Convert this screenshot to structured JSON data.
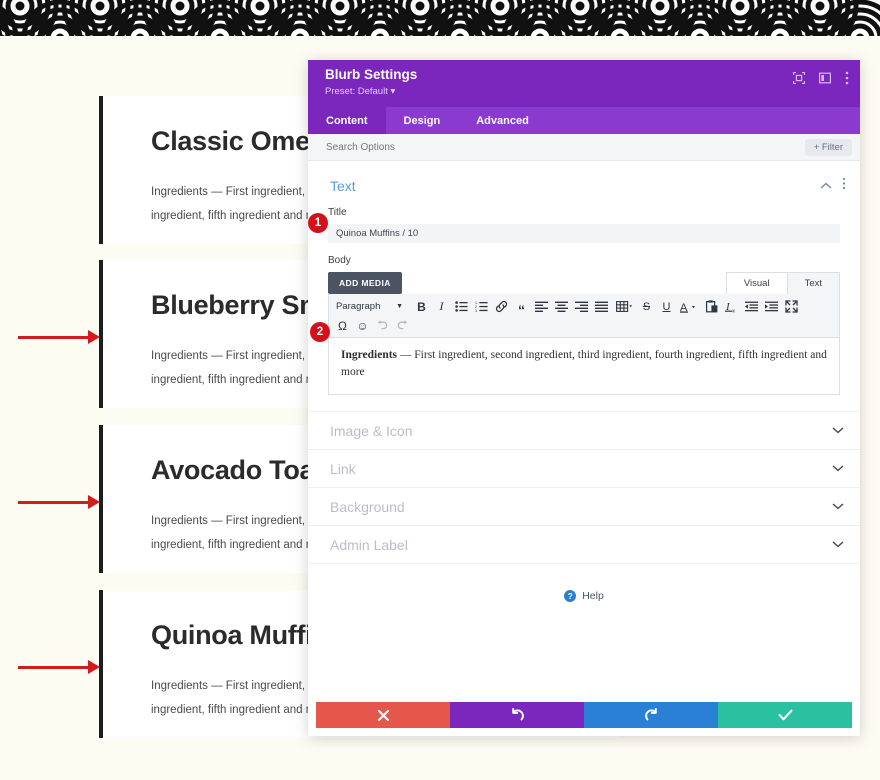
{
  "page": {
    "background_color": "#fdfcf3",
    "accent_purple": "#7b27bd",
    "annotation_color": "#d4101a"
  },
  "decor": {
    "pattern_name": "seigaiha-wave-pattern"
  },
  "recipe_cards": [
    {
      "title": "Classic Omelet",
      "body_label": "Ingredients",
      "body_line1": "Ingredients — First ingredient, second ingredient, third",
      "body_line2": "ingredient, fifth ingredient and more",
      "has_arrow": false
    },
    {
      "title": "Blueberry Smoothie",
      "body_label": "Ingredients",
      "body_line1": "Ingredients — First ingredient, second ingredient, third",
      "body_line2": "ingredient, fifth ingredient and more",
      "has_arrow": true
    },
    {
      "title": "Avocado Toast",
      "body_label": "Ingredients",
      "body_line1": "Ingredients — First ingredient, second ingredient, third",
      "body_line2": "ingredient, fifth ingredient and more",
      "has_arrow": true
    },
    {
      "title": "Quinoa Muffins",
      "body_label": "Ingredients",
      "body_line1": "Ingredients — First ingredient, second ingredient, third",
      "body_line2": "ingredient, fifth ingredient and more",
      "has_arrow": true
    }
  ],
  "annotations": [
    {
      "number": "1",
      "target": "title-field"
    },
    {
      "number": "2",
      "target": "body-editor"
    }
  ],
  "modal": {
    "title": "Blurb Settings",
    "preset": "Preset: Default ▾",
    "header_icons": [
      {
        "name": "fullscreen-icon"
      },
      {
        "name": "layout-panel-icon"
      },
      {
        "name": "more-vertical-icon"
      }
    ],
    "tabs": [
      {
        "label": "Content",
        "active": true
      },
      {
        "label": "Design",
        "active": false
      },
      {
        "label": "Advanced",
        "active": false
      }
    ],
    "search": {
      "placeholder": "Search Options",
      "value": "",
      "filter_label": "+ Filter"
    },
    "text_section": {
      "heading": "Text",
      "collapse_icon": "chevron-up-icon",
      "menu_icon": "more-vertical-icon",
      "title_field": {
        "label": "Title",
        "value": "Quinoa Muffins / 10"
      },
      "body_field": {
        "label": "Body",
        "add_media_label": "ADD MEDIA",
        "editor_tabs": [
          {
            "label": "Visual",
            "selected": true
          },
          {
            "label": "Text",
            "selected": false
          }
        ],
        "format_select": "Paragraph",
        "toolbar_row1": [
          {
            "name": "bold-icon",
            "glyph": "B"
          },
          {
            "name": "italic-icon",
            "glyph": "I"
          },
          {
            "name": "bulleted-list-icon",
            "glyph": "☰"
          },
          {
            "name": "numbered-list-icon",
            "glyph": "☰"
          },
          {
            "name": "link-icon",
            "glyph": "🔗"
          },
          {
            "name": "blockquote-icon",
            "glyph": "“"
          },
          {
            "name": "align-left-icon",
            "glyph": "☰"
          },
          {
            "name": "align-center-icon",
            "glyph": "☰"
          },
          {
            "name": "align-right-icon",
            "glyph": "☰"
          },
          {
            "name": "align-justify-icon",
            "glyph": "☰"
          },
          {
            "name": "table-icon",
            "glyph": "▦"
          },
          {
            "name": "strikethrough-icon",
            "glyph": "S"
          },
          {
            "name": "underline-icon",
            "glyph": "U"
          },
          {
            "name": "text-color-icon",
            "glyph": "A"
          },
          {
            "name": "paste-as-text-icon",
            "glyph": "📋"
          },
          {
            "name": "clear-formatting-icon",
            "glyph": "I"
          },
          {
            "name": "outdent-icon",
            "glyph": "☰"
          },
          {
            "name": "indent-icon",
            "glyph": "☰"
          },
          {
            "name": "fullscreen-icon",
            "glyph": "⤢"
          }
        ],
        "toolbar_row2": [
          {
            "name": "special-character-icon",
            "glyph": "Ω"
          },
          {
            "name": "emoji-icon",
            "glyph": "☺"
          },
          {
            "name": "undo-icon",
            "glyph": "↩"
          },
          {
            "name": "redo-icon",
            "glyph": "↪"
          }
        ],
        "content_bold": "Ingredients",
        "content_rest": " — First ingredient, second ingredient, third ingredient, fourth ingredient, fifth ingredient and more"
      }
    },
    "collapsed_sections": [
      {
        "label": "Image & Icon"
      },
      {
        "label": "Link"
      },
      {
        "label": "Background"
      },
      {
        "label": "Admin Label"
      }
    ],
    "help": {
      "label": "Help",
      "icon": "question-mark-icon"
    },
    "actions": [
      {
        "name": "cancel",
        "glyph": "✖",
        "color": "#e5564b"
      },
      {
        "name": "undo",
        "glyph": "↺",
        "color": "#7b27bd"
      },
      {
        "name": "redo",
        "glyph": "↻",
        "color": "#2a80d4"
      },
      {
        "name": "save",
        "glyph": "✔",
        "color": "#2ac1a0"
      }
    ]
  }
}
